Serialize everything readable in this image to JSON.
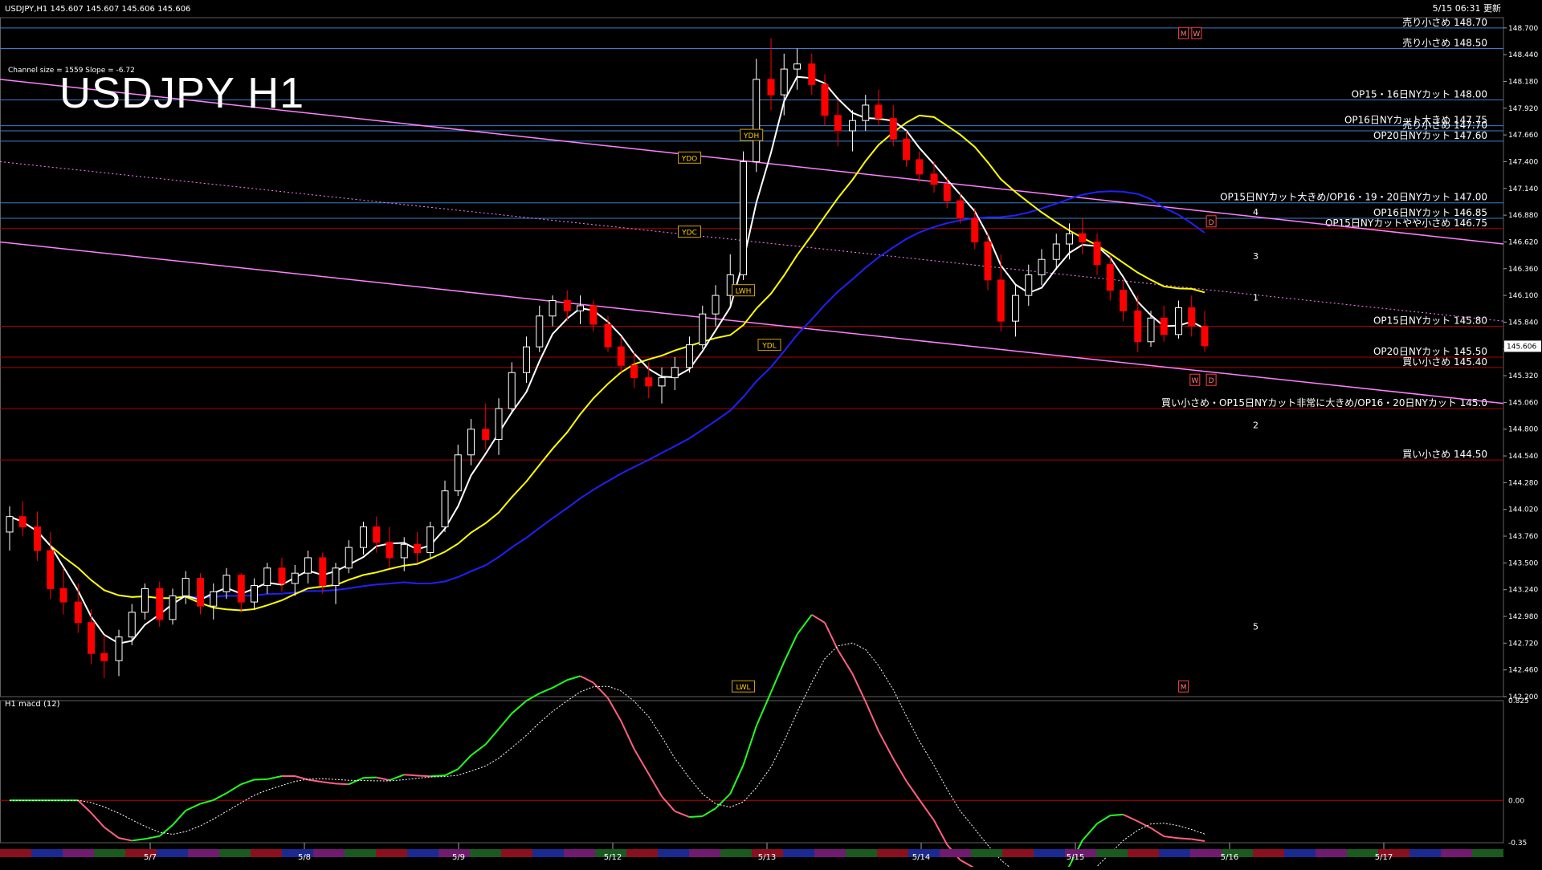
{
  "header": {
    "symbol_info": "USDJPY,H1  145.607 145.607 145.606 145.606",
    "update_time": "5/15 06:31 更新",
    "channel_info": "Channel size = 1559 Slope = -6.72",
    "title": "USDJPY H1"
  },
  "subwindow": {
    "label": "H1  macd (12)"
  },
  "colors": {
    "background": "#000000",
    "bull_candle": "#ffffff",
    "bear_candle": "#ff0000",
    "level_line": "#b00000",
    "fast_ma": "#ffffff",
    "slow_ma": "#ffff00",
    "long_ma": "#2020ff",
    "channel": "#ff80ff",
    "macd_up": "#20ff20",
    "macd_down": "#ff6080"
  },
  "chart_data": {
    "type": "candlestick",
    "symbol": "USDJPY",
    "timeframe": "H1",
    "current_price": "145.606",
    "ylim": [
      142.2,
      148.8
    ],
    "y_ticks": [
      "148.700",
      "148.440",
      "148.180",
      "147.920",
      "147.660",
      "147.400",
      "147.140",
      "146.880",
      "146.620",
      "146.360",
      "146.100",
      "145.840",
      "145.580",
      "145.320",
      "145.060",
      "144.800",
      "144.540",
      "144.280",
      "144.020",
      "143.760",
      "143.500",
      "143.240",
      "142.980",
      "142.720",
      "142.460",
      "142.200"
    ],
    "x_labels": [
      "5/7",
      "5/8",
      "5/9",
      "5/12",
      "5/13",
      "5/14",
      "5/15",
      "5/16",
      "5/17"
    ],
    "levels": [
      {
        "price": 148.7,
        "label": "売り小さめ 148.70"
      },
      {
        "price": 148.5,
        "label": "売り小さめ 148.50"
      },
      {
        "price": 148.0,
        "label": "OP15・16日NYカット 148.00"
      },
      {
        "price": 147.75,
        "label": "OP16日NYカット大きめ 147.75"
      },
      {
        "price": 147.7,
        "label": "売り小さめ 147.70"
      },
      {
        "price": 147.6,
        "label": "OP20日NYカット 147.60"
      },
      {
        "price": 147.0,
        "label": "OP15日NYカット大きめ/OP16・19・20日NYカット 147.00"
      },
      {
        "price": 146.85,
        "label": "OP16日NYカット 146.85"
      },
      {
        "price": 146.75,
        "label": "OP15日NYカットやや小さめ 146.75"
      },
      {
        "price": 145.8,
        "label": "OP15日NYカット 145.80"
      },
      {
        "price": 145.5,
        "label": "OP20日NYカット 145.50"
      },
      {
        "price": 145.4,
        "label": "買い小さめ 145.40"
      },
      {
        "price": 145.0,
        "label": "買い小さめ・OP15日NYカット非常に大きめ/OP16・20日NYカット 145.0"
      },
      {
        "price": 144.5,
        "label": "買い小さめ 144.50"
      }
    ],
    "markers": [
      {
        "label": "YDH",
        "price": 147.66,
        "x": 4.55
      },
      {
        "label": "YDO",
        "price": 147.44,
        "x": 4.17
      },
      {
        "label": "YDC",
        "price": 146.72,
        "x": 4.17
      },
      {
        "label": "LWH",
        "price": 146.15,
        "x": 4.5
      },
      {
        "label": "YDL",
        "price": 145.62,
        "x": 4.66
      },
      {
        "label": "LWL",
        "price": 142.3,
        "x": 4.5
      },
      {
        "label": "M",
        "price": 148.65,
        "x": 7.2
      },
      {
        "label": "W",
        "price": 148.65,
        "x": 7.28
      },
      {
        "label": "D",
        "price": 146.82,
        "x": 7.37
      },
      {
        "label": "W",
        "price": 145.28,
        "x": 7.27
      },
      {
        "label": "D",
        "price": 145.28,
        "x": 7.37
      },
      {
        "label": "M",
        "price": 142.3,
        "x": 7.2
      }
    ],
    "wave_labels": [
      {
        "label": "1",
        "price": 146.05
      },
      {
        "label": "2",
        "price": 144.81
      },
      {
        "label": "3",
        "price": 146.45
      },
      {
        "label": "4",
        "price": 146.88
      },
      {
        "label": "5",
        "price": 142.85
      }
    ],
    "candles": [
      [
        0.0,
        143.8,
        144.05,
        143.62,
        143.95
      ],
      [
        0.08,
        143.95,
        144.1,
        143.76,
        143.85
      ],
      [
        0.17,
        143.85,
        144.0,
        143.52,
        143.62
      ],
      [
        0.25,
        143.62,
        143.8,
        143.15,
        143.25
      ],
      [
        0.33,
        143.25,
        143.45,
        143.0,
        143.12
      ],
      [
        0.42,
        143.12,
        143.3,
        142.82,
        142.92
      ],
      [
        0.5,
        142.92,
        143.05,
        142.52,
        142.62
      ],
      [
        0.58,
        142.62,
        142.8,
        142.38,
        142.55
      ],
      [
        0.67,
        142.55,
        142.85,
        142.4,
        142.78
      ],
      [
        0.75,
        142.78,
        143.1,
        142.7,
        143.02
      ],
      [
        0.83,
        143.02,
        143.3,
        142.95,
        143.25
      ],
      [
        0.92,
        143.25,
        143.32,
        142.88,
        142.95
      ],
      [
        1.0,
        142.95,
        143.25,
        142.9,
        143.18
      ],
      [
        1.08,
        143.18,
        143.42,
        143.1,
        143.35
      ],
      [
        1.17,
        143.35,
        143.4,
        143.0,
        143.08
      ],
      [
        1.25,
        143.08,
        143.3,
        142.95,
        143.22
      ],
      [
        1.33,
        143.22,
        143.45,
        143.15,
        143.38
      ],
      [
        1.42,
        143.38,
        143.4,
        143.02,
        143.12
      ],
      [
        1.5,
        143.12,
        143.35,
        143.05,
        143.28
      ],
      [
        1.58,
        143.28,
        143.5,
        143.2,
        143.45
      ],
      [
        1.67,
        143.45,
        143.55,
        143.22,
        143.3
      ],
      [
        1.75,
        143.3,
        143.48,
        143.18,
        143.4
      ],
      [
        1.83,
        143.4,
        143.62,
        143.3,
        143.55
      ],
      [
        1.92,
        143.55,
        143.6,
        143.2,
        143.28
      ],
      [
        2.0,
        143.28,
        143.5,
        143.1,
        143.45
      ],
      [
        2.08,
        143.45,
        143.72,
        143.4,
        143.65
      ],
      [
        2.17,
        143.65,
        143.9,
        143.58,
        143.85
      ],
      [
        2.25,
        143.85,
        143.95,
        143.6,
        143.7
      ],
      [
        2.33,
        143.7,
        143.85,
        143.45,
        143.55
      ],
      [
        2.42,
        143.55,
        143.75,
        143.42,
        143.68
      ],
      [
        2.5,
        143.68,
        143.8,
        143.5,
        143.6
      ],
      [
        2.58,
        143.6,
        143.9,
        143.55,
        143.85
      ],
      [
        2.67,
        143.85,
        144.3,
        143.8,
        144.2
      ],
      [
        2.75,
        144.2,
        144.65,
        144.15,
        144.55
      ],
      [
        2.83,
        144.55,
        144.9,
        144.45,
        144.8
      ],
      [
        2.92,
        144.8,
        145.05,
        144.6,
        144.7
      ],
      [
        3.0,
        144.7,
        145.1,
        144.55,
        145.0
      ],
      [
        3.08,
        145.0,
        145.45,
        144.95,
        145.35
      ],
      [
        3.17,
        145.35,
        145.7,
        145.25,
        145.6
      ],
      [
        3.25,
        145.6,
        146.0,
        145.55,
        145.9
      ],
      [
        3.33,
        145.9,
        146.1,
        145.8,
        146.05
      ],
      [
        3.42,
        146.05,
        146.15,
        145.85,
        145.95
      ],
      [
        3.5,
        145.95,
        146.1,
        145.82,
        146.0
      ],
      [
        3.58,
        146.0,
        146.05,
        145.75,
        145.82
      ],
      [
        3.67,
        145.82,
        145.9,
        145.55,
        145.6
      ],
      [
        3.75,
        145.6,
        145.7,
        145.35,
        145.42
      ],
      [
        3.83,
        145.42,
        145.55,
        145.2,
        145.3
      ],
      [
        3.92,
        145.3,
        145.45,
        145.1,
        145.22
      ],
      [
        4.0,
        145.22,
        145.4,
        145.05,
        145.3
      ],
      [
        4.08,
        145.3,
        145.5,
        145.18,
        145.4
      ],
      [
        4.17,
        145.4,
        145.7,
        145.35,
        145.62
      ],
      [
        4.25,
        145.62,
        146.0,
        145.58,
        145.92
      ],
      [
        4.33,
        145.92,
        146.2,
        145.8,
        146.1
      ],
      [
        4.42,
        146.1,
        146.5,
        146.0,
        146.3
      ],
      [
        4.5,
        146.3,
        147.5,
        146.25,
        147.4
      ],
      [
        4.58,
        147.4,
        148.4,
        147.3,
        148.2
      ],
      [
        4.67,
        148.2,
        148.6,
        147.9,
        148.05
      ],
      [
        4.75,
        148.05,
        148.45,
        147.85,
        148.3
      ],
      [
        4.83,
        148.3,
        148.5,
        148.1,
        148.35
      ],
      [
        4.92,
        148.35,
        148.45,
        148.05,
        148.15
      ],
      [
        5.0,
        148.15,
        148.25,
        147.75,
        147.85
      ],
      [
        5.08,
        147.85,
        148.0,
        147.55,
        147.7
      ],
      [
        5.17,
        147.7,
        147.9,
        147.5,
        147.8
      ],
      [
        5.25,
        147.8,
        148.05,
        147.7,
        147.95
      ],
      [
        5.33,
        147.95,
        148.1,
        147.75,
        147.82
      ],
      [
        5.42,
        147.82,
        147.95,
        147.55,
        147.62
      ],
      [
        5.5,
        147.62,
        147.7,
        147.35,
        147.42
      ],
      [
        5.58,
        147.42,
        147.5,
        147.2,
        147.28
      ],
      [
        5.67,
        147.28,
        147.4,
        147.1,
        147.18
      ],
      [
        5.75,
        147.18,
        147.25,
        146.95,
        147.02
      ],
      [
        5.83,
        147.02,
        147.1,
        146.8,
        146.85
      ],
      [
        5.92,
        146.85,
        146.95,
        146.55,
        146.62
      ],
      [
        6.0,
        146.62,
        146.7,
        146.15,
        146.25
      ],
      [
        6.08,
        146.25,
        146.5,
        145.75,
        145.85
      ],
      [
        6.17,
        145.85,
        146.2,
        145.7,
        146.1
      ],
      [
        6.25,
        146.1,
        146.4,
        146.0,
        146.3
      ],
      [
        6.33,
        146.3,
        146.55,
        146.2,
        146.45
      ],
      [
        6.42,
        146.45,
        146.7,
        146.35,
        146.6
      ],
      [
        6.5,
        146.6,
        146.8,
        146.45,
        146.7
      ],
      [
        6.58,
        146.7,
        146.85,
        146.5,
        146.62
      ],
      [
        6.67,
        146.62,
        146.7,
        146.3,
        146.4
      ],
      [
        6.75,
        146.4,
        146.5,
        146.05,
        146.15
      ],
      [
        6.83,
        146.15,
        146.25,
        145.85,
        145.95
      ],
      [
        6.92,
        145.95,
        146.1,
        145.55,
        145.65
      ],
      [
        7.0,
        145.65,
        145.95,
        145.6,
        145.88
      ],
      [
        7.08,
        145.88,
        146.0,
        145.65,
        145.72
      ],
      [
        7.17,
        145.72,
        146.05,
        145.68,
        145.98
      ],
      [
        7.25,
        145.98,
        146.1,
        145.7,
        145.8
      ],
      [
        7.33,
        145.8,
        145.95,
        145.55,
        145.61
      ]
    ],
    "macd": {
      "ylim": [
        -0.35,
        0.825
      ],
      "y_ticks": [
        "0.825",
        "0.00",
        "-0.35"
      ]
    }
  }
}
